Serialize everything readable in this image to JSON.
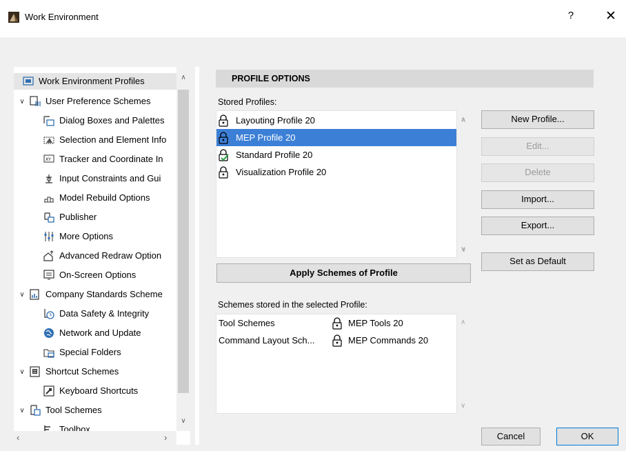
{
  "window": {
    "title": "Work Environment",
    "help_label": "?",
    "close_label": "✕"
  },
  "tree": {
    "items": [
      {
        "label": "Work Environment Profiles",
        "icon": "profiles-icon"
      },
      {
        "label": "User Preference Schemes",
        "icon": "user-preferences-icon"
      },
      {
        "label": "Dialog Boxes and Palettes",
        "icon": "dialog-boxes-icon"
      },
      {
        "label": "Selection and Element Info",
        "icon": "selection-info-icon"
      },
      {
        "label": "Tracker and Coordinate In",
        "icon": "tracker-icon"
      },
      {
        "label": "Input Constraints and Gui",
        "icon": "input-constraints-icon"
      },
      {
        "label": "Model Rebuild Options",
        "icon": "model-rebuild-icon"
      },
      {
        "label": "Publisher",
        "icon": "publisher-icon"
      },
      {
        "label": "More Options",
        "icon": "more-options-icon"
      },
      {
        "label": "Advanced Redraw Option",
        "icon": "advanced-redraw-icon"
      },
      {
        "label": "On-Screen Options",
        "icon": "on-screen-options-icon"
      },
      {
        "label": "Company Standards Scheme",
        "icon": "company-standards-icon"
      },
      {
        "label": "Data Safety & Integrity",
        "icon": "data-safety-icon"
      },
      {
        "label": "Network and Update",
        "icon": "network-icon"
      },
      {
        "label": "Special Folders",
        "icon": "special-folders-icon"
      },
      {
        "label": "Shortcut Schemes",
        "icon": "shortcut-schemes-icon"
      },
      {
        "label": "Keyboard Shortcuts",
        "icon": "keyboard-shortcuts-icon"
      },
      {
        "label": "Tool Schemes",
        "icon": "tool-schemes-icon"
      },
      {
        "label": "Toolbox",
        "icon": "toolbox-icon"
      }
    ]
  },
  "profile_options": {
    "header": "PROFILE OPTIONS",
    "stored_profiles_label": "Stored Profiles:",
    "profiles": [
      {
        "label": "Layouting Profile 20",
        "selected": false,
        "default": false
      },
      {
        "label": "MEP Profile 20",
        "selected": true,
        "default": false
      },
      {
        "label": "Standard Profile 20",
        "selected": false,
        "default": true
      },
      {
        "label": "Visualization Profile 20",
        "selected": false,
        "default": false
      }
    ],
    "apply_button": "Apply Schemes of Profile",
    "schemes_label": "Schemes stored in the selected Profile:",
    "schemes": [
      {
        "name": "Tool Schemes",
        "value": "MEP Tools 20"
      },
      {
        "name": "Command Layout Sch...",
        "value": "MEP Commands 20"
      }
    ]
  },
  "buttons": {
    "new_profile": "New Profile...",
    "edit": "Edit...",
    "delete": "Delete",
    "import": "Import...",
    "export": "Export...",
    "set_default": "Set as Default",
    "cancel": "Cancel",
    "ok": "OK"
  },
  "colors": {
    "selection": "#3c7fd6",
    "default_check": "#2ea043",
    "header_bg": "#d9d9d9"
  }
}
